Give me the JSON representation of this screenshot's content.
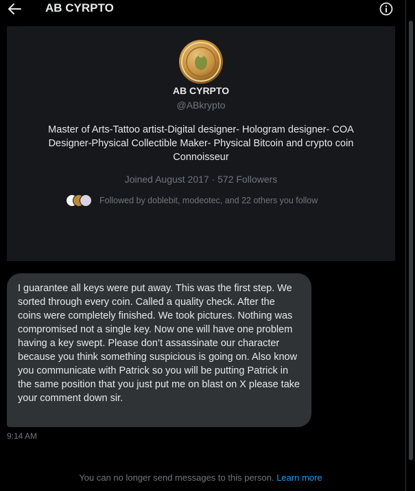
{
  "header": {
    "title": "AB CYRPTO",
    "back_icon": "arrow-left-icon",
    "info_icon": "info-circle-icon"
  },
  "profile": {
    "name": "AB CYRPTO",
    "handle": "@ABkrypto",
    "bio": "Master of Arts-Tattoo artist-Digital designer- Hologram designer- COA Designer-Physical Collectible Maker- Physical Bitcoin and crypto coin Connoisseur",
    "joined": "Joined August 2017 · 572 Followers",
    "followed_by": "Followed by doblebit, modeotec, and 22 others you follow"
  },
  "message": {
    "text": "I guarantee all keys were put away. This was the first step. We sorted through every coin. Called a quality check. After the coins were completely finished. We took pictures. Nothing was compromised not a single key. Now one will have one problem having a key swept. Please don’t assassinate our character because you think something suspicious is going on. Also know you communicate with Patrick so you will be putting Patrick in the same position that you just put me on blast on X please take your comment down sir.",
    "time": "9:14 AM"
  },
  "footer": {
    "notice": "You can no longer send messages to this person.",
    "learn_more": "Learn more"
  },
  "colors": {
    "background": "#000000",
    "card": "#16181c",
    "bubble": "#2f3336",
    "muted_text": "#71767b",
    "link": "#1d9bf0"
  }
}
